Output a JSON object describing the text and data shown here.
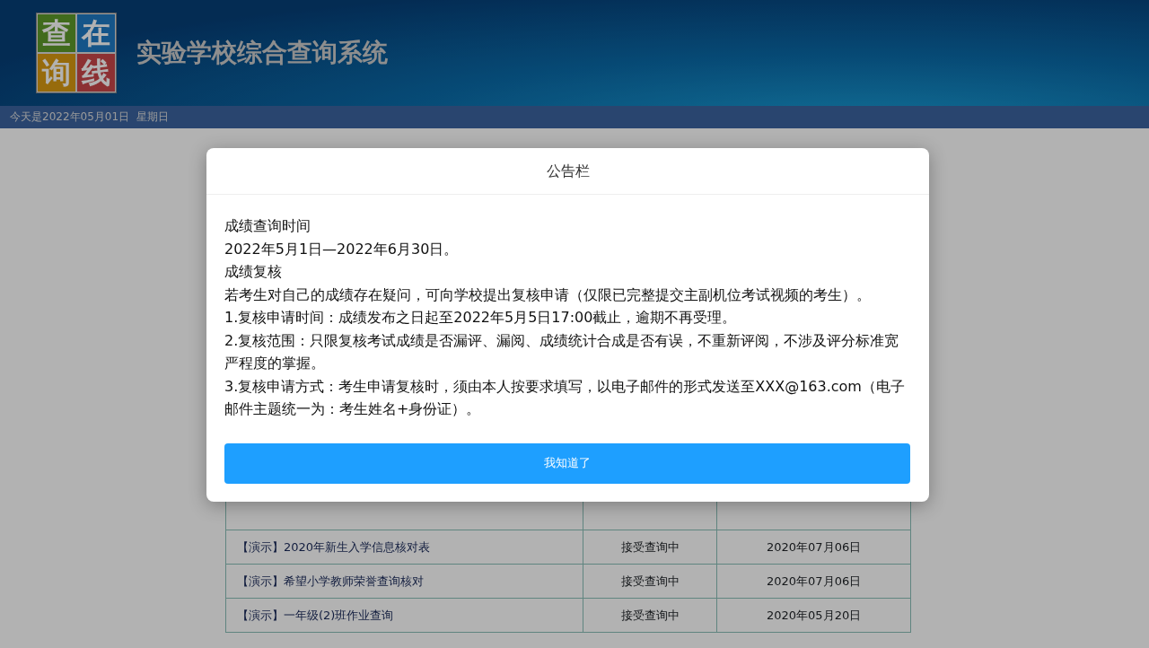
{
  "header": {
    "logo": [
      "查",
      "在",
      "询",
      "线"
    ],
    "title": "实验学校综合查询系统"
  },
  "date_bar": {
    "text": "今天是2022年05月01日  星期日"
  },
  "table": {
    "rows": [
      {
        "title": "【演示】2020年新生入学信息核对表",
        "status": "接受查询中",
        "date": "2020年07月06日"
      },
      {
        "title": "【演示】希望小学教师荣誉查询核对",
        "status": "接受查询中",
        "date": "2020年07月06日"
      },
      {
        "title": "【演示】一年级(2)班作业查询",
        "status": "接受查询中",
        "date": "2020年05月20日"
      }
    ]
  },
  "modal": {
    "title": "公告栏",
    "paragraphs": [
      "成绩查询时间",
      "2022年5月1日—2022年6月30日。",
      "成绩复核",
      "若考生对自己的成绩存在疑问，可向学校提出复核申请（仅限已完整提交主副机位考试视频的考生）。",
      "1.复核申请时间：成绩发布之日起至2022年5月5日17:00截止，逾期不再受理。",
      "2.复核范围：只限复核考试成绩是否漏评、漏阅、成绩统计合成是否有误，不重新评阅，不涉及评分标准宽严程度的掌握。",
      "3.复核申请方式：考生申请复核时，须由本人按要求填写，以电子邮件的形式发送至XXX@163.com（电子邮件主题统一为：考生姓名+身份证）。"
    ],
    "button": "我知道了"
  }
}
